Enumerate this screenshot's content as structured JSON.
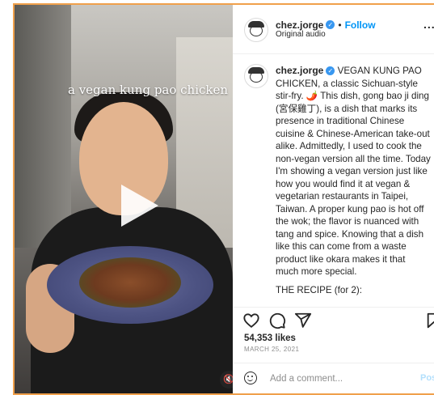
{
  "video": {
    "overlay_caption": "a vegan kung pao chicken",
    "play_icon": "play-icon",
    "sound_icon": "speaker-muted-icon"
  },
  "header": {
    "username": "chez.jorge",
    "separator": "•",
    "follow_label": "Follow",
    "subtitle": "Original audio",
    "more_label": "..."
  },
  "caption": {
    "username": "chez.jorge",
    "text": "VEGAN KUNG PAO CHICKEN, a classic Sichuan-style stir-fry. 🌶️ This dish, gong bao ji ding (宮保雞丁), is a dish that marks its presence in traditional Chinese cuisine & Chinese-American take-out alike. Admittedly, I used to cook the non-vegan version all the time. Today I'm showing a vegan version just like how you would find it at vegan & vegetarian restaurants in Taipei, Taiwan. A proper kung pao is hot off the wok; the flavor is nuanced with tang and spice. Knowing that a dish like this can come from a waste product like okara makes it that much more special.",
    "recipe_heading": "THE RECIPE (for 2):"
  },
  "actions": {
    "likes": "54,353 likes",
    "date": "MARCH 25, 2021"
  },
  "comment_box": {
    "placeholder": "Add a comment...",
    "post_label": "Post"
  },
  "colors": {
    "accent_blue": "#0095f6",
    "verified_blue": "#3897f0",
    "frame_orange": "#f0a04b"
  }
}
